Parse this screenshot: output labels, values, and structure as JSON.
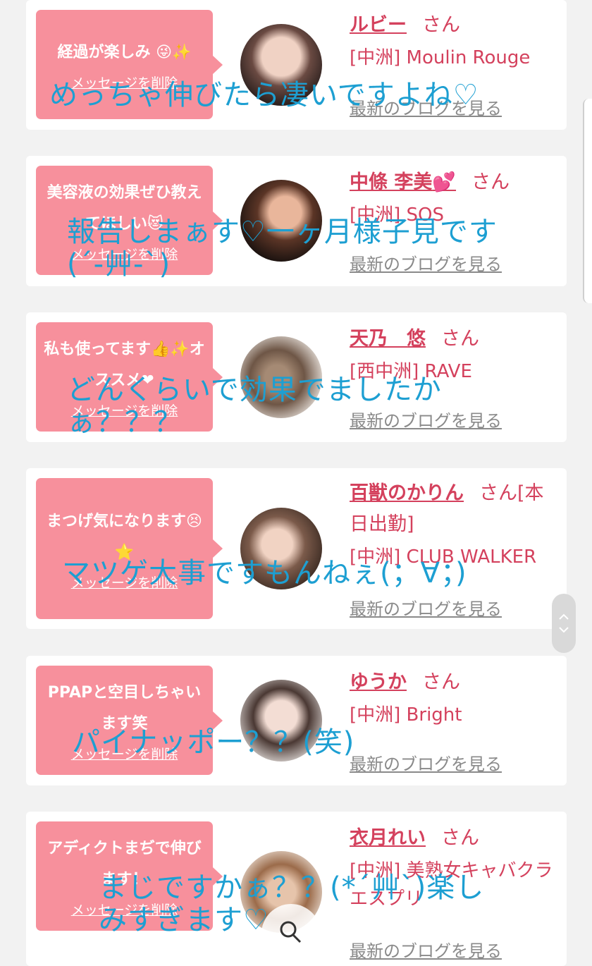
{
  "cards": [
    {
      "message": "経過が楽しみ",
      "emoji": "😜✨",
      "delete_label": "メッセージを削除",
      "name": "ルビー",
      "san": "さん",
      "shop": "[中洲] Moulin Rouge",
      "blog_link": "最新のブログを見る",
      "comment": "めっちゃ伸びたら凄いですよね♡"
    },
    {
      "message": "美容液の効果ぜひ教えてほしい",
      "emoji": "😻",
      "delete_label": "メッセージを削除",
      "name": "中條 李美",
      "name_emoji": "💕",
      "san": "さん",
      "shop": "[中洲] SOS",
      "blog_link": "最新のブログを見る",
      "comment": "報告しまぁす♡一ヶ月様子見です(´-艸-`)"
    },
    {
      "message": "私も使ってます👍✨オススメ❤",
      "delete_label": "メッセージを削除",
      "name": "天乃　悠",
      "san": "さん",
      "shop": "[西中洲] RAVE",
      "blog_link": "最新のブログを見る",
      "comment": "どんくらいで効果でましたかぁ？？？"
    },
    {
      "message": "まつげ気になります😣⭐",
      "delete_label": "メッセージを削除",
      "name": "百獣のかりん",
      "san": "さん[本日出勤]",
      "shop": "[中洲] CLUB WALKER",
      "blog_link": "最新のブログを見る",
      "comment": "マツゲ大事ですもんねぇ(；∀；)"
    },
    {
      "message": "PPAPと空目しちゃいます笑",
      "delete_label": "メッセージを削除",
      "name": "ゆうか",
      "san": "さん",
      "shop": "[中洲] Bright",
      "blog_link": "最新のブログを見る",
      "comment": "パイナッポー？？(笑)"
    },
    {
      "message": "アディクトまぢで伸びます！",
      "delete_label": "メッセージを削除",
      "name": "衣月れい",
      "san": "さん",
      "shop": "[中洲] 美熟女キャバクラ エスプリ",
      "blog_link": "最新のブログを見る",
      "comment": "まじですかぁ？？(*´艸`)楽しみすぎます♡"
    }
  ],
  "overlay_color": "#1d9fd2",
  "accent_color": "#d4415d",
  "bubble_color": "#f7909c"
}
